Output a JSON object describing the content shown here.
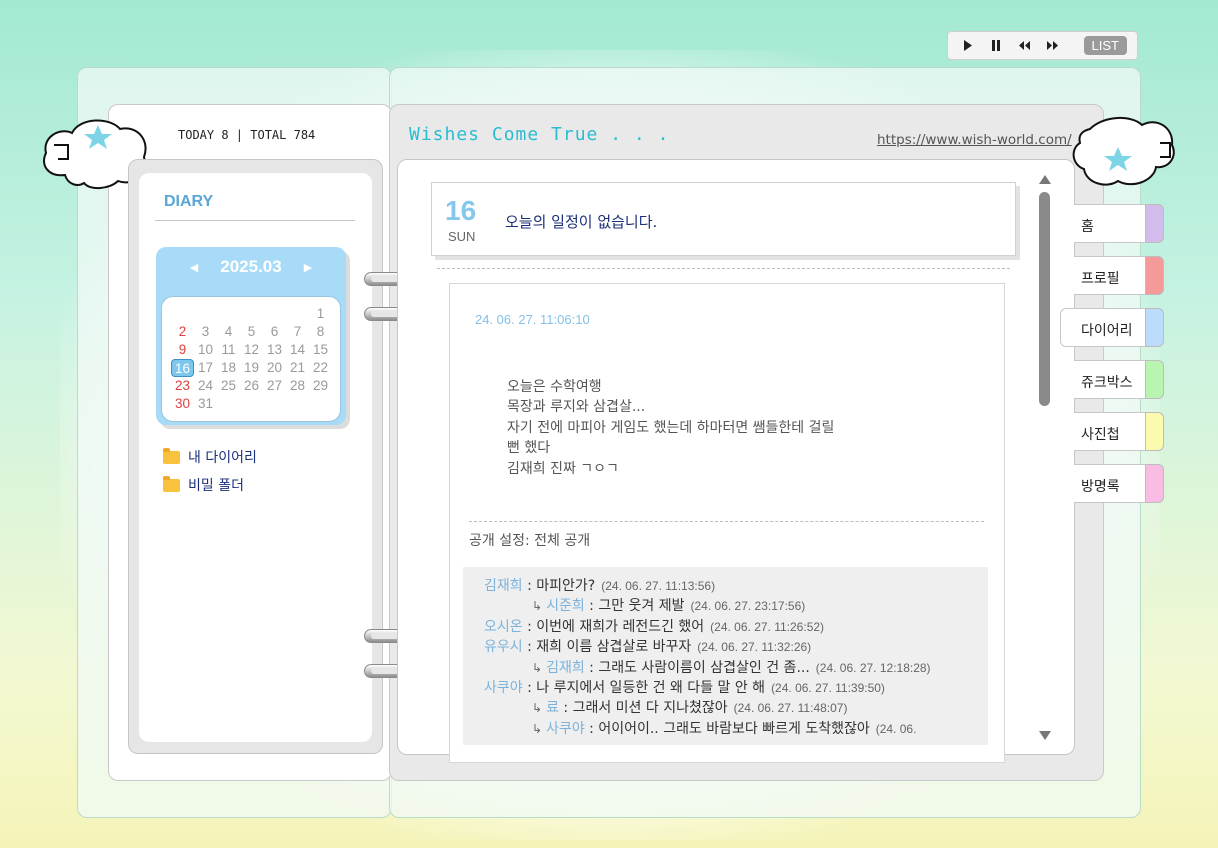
{
  "player": {
    "play_label": "▶",
    "pause_label": "❚❚",
    "prev_label": "◀◀",
    "next_label": "▶▶",
    "list_label": "LIST"
  },
  "header": {
    "counter": "TODAY 8 | TOTAL 784",
    "site_title": "Wishes Come True . . .",
    "site_url": "https://www.wish-world.com/"
  },
  "sidebar": {
    "title": "DIARY",
    "calendar": {
      "year_month": "2025.03",
      "prev_label": "◀",
      "next_label": "▶",
      "weeks": [
        [
          "",
          "",
          "",
          "",
          "",
          "",
          "1"
        ],
        [
          "2",
          "3",
          "4",
          "5",
          "6",
          "7",
          "8"
        ],
        [
          "9",
          "10",
          "11",
          "12",
          "13",
          "14",
          "15"
        ],
        [
          "16",
          "17",
          "18",
          "19",
          "20",
          "21",
          "22"
        ],
        [
          "23",
          "24",
          "25",
          "26",
          "27",
          "28",
          "29"
        ],
        [
          "30",
          "31",
          "",
          "",
          "",
          "",
          ""
        ]
      ],
      "selected_day": "16"
    },
    "folders": [
      {
        "label": "내 다이어리"
      },
      {
        "label": "비밀 폴더"
      }
    ]
  },
  "schedule": {
    "day_number": "16",
    "weekday": "SUN",
    "message": "오늘의 일정이 없습니다."
  },
  "entry": {
    "timestamp": "24. 06. 27. 11:06:10",
    "lines": [
      "오늘은 수학여행",
      "목장과 루지와 삼겹살...",
      "자기 전에 마피아 게임도 했는데 하마터면 쌤들한테 걸릴",
      "뻔 했다",
      "김재희 진짜 ㄱㅇㄱ"
    ],
    "privacy": "공개 설정: 전체 공개"
  },
  "comments": [
    {
      "type": "top",
      "author": "김재희",
      "text": " : 마피안가?",
      "time": "(24. 06. 27. 11:13:56)"
    },
    {
      "type": "reply",
      "author": "시준희",
      "text": " : 그만 웃겨 제발",
      "time": "(24. 06. 27. 23:17:56)"
    },
    {
      "type": "top",
      "author": "오시온",
      "text": " : 이번에 재희가 레전드긴 했어",
      "time": "(24. 06. 27. 11:26:52)"
    },
    {
      "type": "top",
      "author": "유우시",
      "text": " : 재희 이름 삼겹살로 바꾸자",
      "time": "(24. 06. 27. 11:32:26)"
    },
    {
      "type": "reply",
      "author": "김재희",
      "text": " : 그래도 사람이름이 삼겹살인 건 좀...",
      "time": "(24. 06. 27. 12:18:28)"
    },
    {
      "type": "top",
      "author": "사쿠야",
      "text": " : 나 루지에서 일등한 건 왜 다들 말 안 해",
      "time": "(24. 06. 27. 11:39:50)"
    },
    {
      "type": "reply",
      "author": "료",
      "text": " : 그래서 미션 다 지나쳤잖아",
      "time": "(24. 06. 27. 11:48:07)"
    },
    {
      "type": "reply",
      "author": "사쿠야",
      "text": " : 어이어이.. 그래도 바람보다 빠르게 도착했잖아",
      "time": "(24. 06."
    }
  ],
  "tabs": [
    {
      "label": "홈",
      "color": "#d2bcec"
    },
    {
      "label": "프로필",
      "color": "#f49a98"
    },
    {
      "label": "다이어리",
      "color": "#bcdcfb"
    },
    {
      "label": "쥬크박스",
      "color": "#b9f5b1"
    },
    {
      "label": "사진첩",
      "color": "#fbfbb0"
    },
    {
      "label": "방명록",
      "color": "#f9bce2"
    }
  ],
  "colors": {
    "accent_blue": "#86c8ec",
    "title_teal": "#2bbcd0",
    "sunday_red": "#e04040"
  }
}
